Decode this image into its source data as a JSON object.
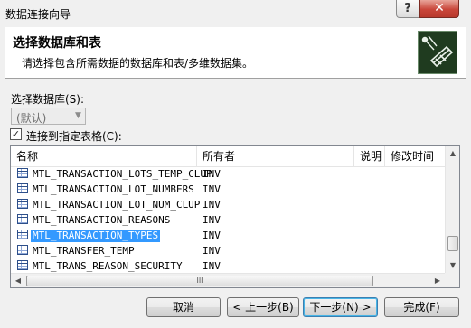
{
  "window": {
    "title": "数据连接向导",
    "help_label": "?",
    "close_label": "✕"
  },
  "header": {
    "title": "选择数据库和表",
    "subtitle": "请选择包含所需数据的数据库和表/多维数据集。",
    "logo_icon": "database-wizard-icon"
  },
  "database": {
    "label": "选择数据库(S):",
    "value": "(默认)",
    "dropdown_arrow": "▼"
  },
  "connect_table": {
    "checked": true,
    "check_mark": "✓",
    "label": "连接到指定表格(C):"
  },
  "list": {
    "columns": [
      "名称",
      "所有者",
      "说明",
      "修改时间"
    ],
    "rows": [
      {
        "name": "MTL_TRANSACTION_LOTS_TEMP_CLUP",
        "owner": "INV"
      },
      {
        "name": "MTL_TRANSACTION_LOT_NUMBERS",
        "owner": "INV"
      },
      {
        "name": "MTL_TRANSACTION_LOT_NUM_CLUP",
        "owner": "INV"
      },
      {
        "name": "MTL_TRANSACTION_REASONS",
        "owner": "INV"
      },
      {
        "name": "MTL_TRANSACTION_TYPES",
        "owner": "INV",
        "selected": true
      },
      {
        "name": "MTL_TRANSFER_TEMP",
        "owner": "INV"
      },
      {
        "name": "MTL_TRANS_REASON_SECURITY",
        "owner": "INV"
      }
    ],
    "thumb_grip": "III",
    "scroll_up": "▲",
    "scroll_down": "▼",
    "scroll_left": "◀",
    "scroll_right": "▶"
  },
  "buttons": {
    "cancel": "取消",
    "back": "< 上一步(B)",
    "next": "下一步(N) >",
    "finish": "完成(F)"
  },
  "colors": {
    "selection": "#3399ff",
    "close_button": "#c9463a",
    "default_button_border": "#3c7fb1"
  }
}
